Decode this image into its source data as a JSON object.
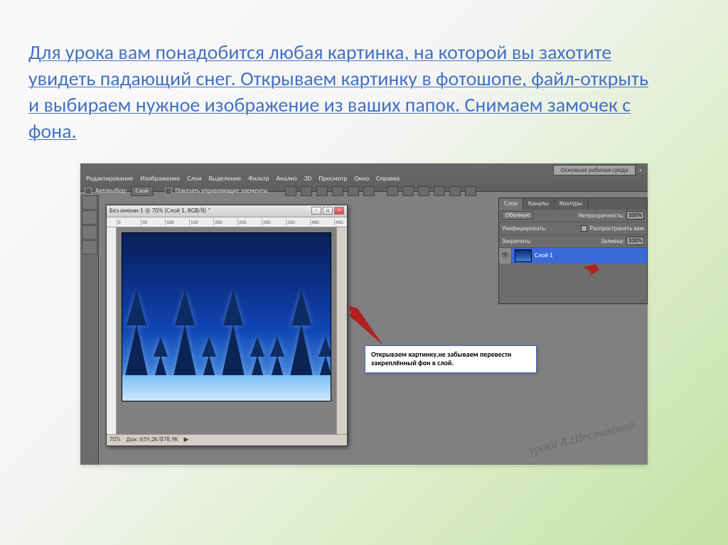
{
  "title_parts": [
    "Для урока вам понадобится любая картинка, на которой вы захотите увидеть падающий снег. Открываем картинку в фотошопе, файл-открыть и выбираем нужное изображение из ваших папок. Снимаем замочек с фона."
  ],
  "workspace": {
    "label": "Основная рабочая среда"
  },
  "menubar": [
    "Редактирование",
    "Изображение",
    "Слои",
    "Выделение",
    "Фильтр",
    "Анализ",
    "3D",
    "Просмотр",
    "Окно",
    "Справка"
  ],
  "options": {
    "auto_select": "Автовыбор:",
    "auto_select_val": "Слой",
    "show_controls": "Показать управляющие элементы"
  },
  "docwin": {
    "title": "Без имени-1 @ 70% (Слой 1, RGB/8) *",
    "zoom": "70%",
    "docinfo": "Док: 659,2K/878,9K",
    "ruler_marks": [
      "0",
      "50",
      "100",
      "150",
      "200",
      "250",
      "300",
      "350",
      "400",
      "450"
    ]
  },
  "layers_panel": {
    "tabs": [
      "Слои",
      "Каналы",
      "Контуры"
    ],
    "mode_label": "Обычные",
    "opacity_label": "Непрозрачность:",
    "opacity_val": "100%",
    "unify_label": "Унифицировать:",
    "propagate": "Распространять каж",
    "lock_label": "Закрепить:",
    "fill_label": "Заливка:",
    "fill_val": "100%",
    "layer_name": "Слой 1"
  },
  "annotation": "Открываем картинку,не забываем перевести закреплённый фон в слой.",
  "watermark": "уроки А.Шестаковой"
}
